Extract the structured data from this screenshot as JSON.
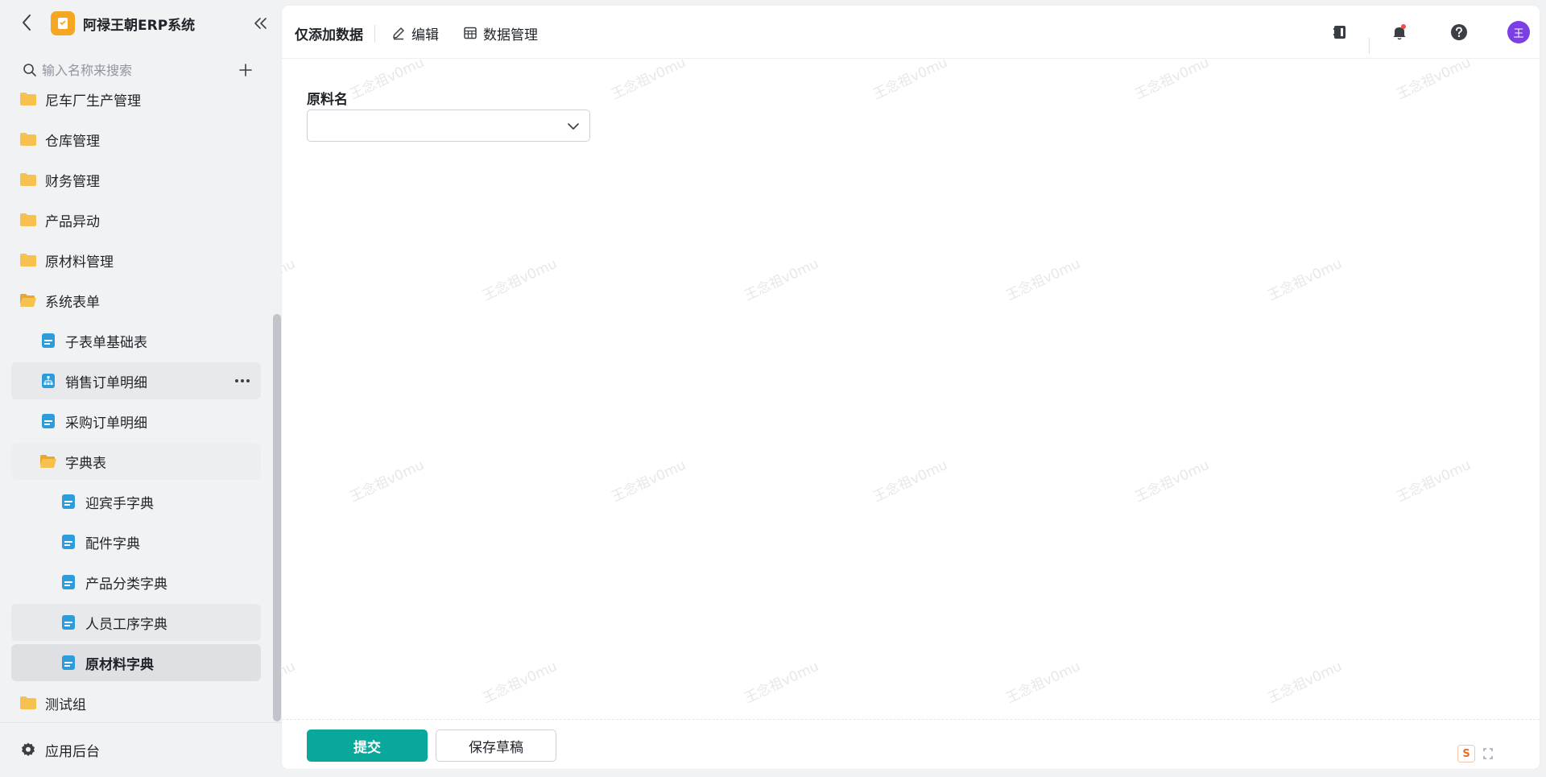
{
  "sidebar": {
    "app_name": "阿禄王朝ERP系统",
    "search_placeholder": "输入名称来搜索",
    "items": [
      {
        "label": "尼车厂生产管理",
        "type": "folder",
        "level": 0
      },
      {
        "label": "仓库管理",
        "type": "folder",
        "level": 0
      },
      {
        "label": "财务管理",
        "type": "folder",
        "level": 0
      },
      {
        "label": "产品异动",
        "type": "folder",
        "level": 0
      },
      {
        "label": "原材料管理",
        "type": "folder",
        "level": 0
      },
      {
        "label": "系统表单",
        "type": "folder-open",
        "level": 0
      },
      {
        "label": "子表单基础表",
        "type": "form",
        "level": 1
      },
      {
        "label": "销售订单明细",
        "type": "report",
        "level": 1
      },
      {
        "label": "采购订单明细",
        "type": "form",
        "level": 1
      },
      {
        "label": "字典表",
        "type": "folder-open",
        "level": 1
      },
      {
        "label": "迎宾手字典",
        "type": "form",
        "level": 2
      },
      {
        "label": "配件字典",
        "type": "form",
        "level": 2
      },
      {
        "label": "产品分类字典",
        "type": "form",
        "level": 2
      },
      {
        "label": "人员工序字典",
        "type": "form",
        "level": 2
      },
      {
        "label": "原材料字典",
        "type": "form",
        "level": 2
      },
      {
        "label": "测试组",
        "type": "folder",
        "level": 0
      }
    ],
    "footer_label": "应用后台"
  },
  "topbar": {
    "title": "仅添加数据",
    "edit_label": "编辑",
    "data_manage_label": "数据管理",
    "avatar_text": "王"
  },
  "form": {
    "field_label": "原料名",
    "field_value": ""
  },
  "footer": {
    "submit_label": "提交",
    "draft_label": "保存草稿",
    "badge_text": "S"
  },
  "watermark_text": "王念祖v0mu",
  "colors": {
    "accent": "#0aa79b",
    "folder": "#f6c14f",
    "form_icon": "#2d9cdb",
    "avatar": "#7b3fe4",
    "notification_dot": "#f54a45"
  }
}
